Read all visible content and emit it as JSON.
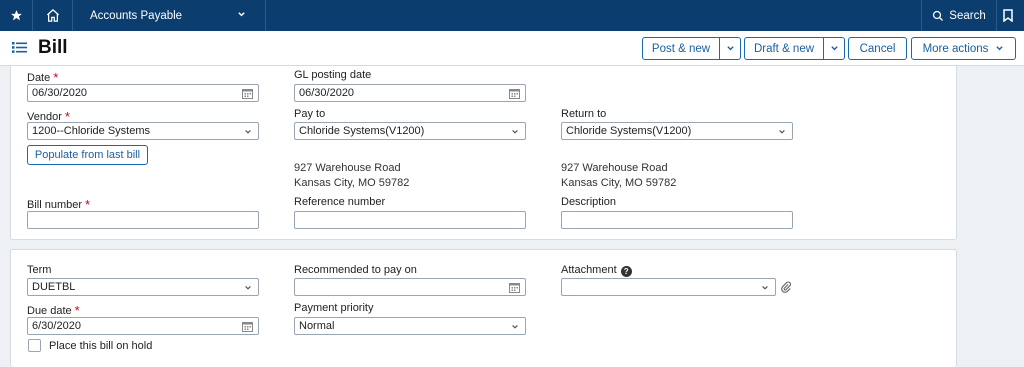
{
  "nav": {
    "module": "Accounts Payable",
    "search_label": "Search"
  },
  "header": {
    "title": "Bill",
    "buttons": {
      "post_new": "Post & new",
      "draft_new": "Draft & new",
      "cancel": "Cancel",
      "more_actions": "More actions"
    }
  },
  "form": {
    "date": {
      "label": "Date",
      "value": "06/30/2020"
    },
    "gl_posting_date": {
      "label": "GL posting date",
      "value": "06/30/2020"
    },
    "vendor": {
      "label": "Vendor",
      "value": "1200--Chloride Systems"
    },
    "pay_to": {
      "label": "Pay to",
      "value": "Chloride Systems(V1200)"
    },
    "return_to": {
      "label": "Return to",
      "value": "Chloride Systems(V1200)"
    },
    "populate_button": "Populate from last bill",
    "pay_to_address": {
      "line1": "927 Warehouse Road",
      "line2": "Kansas City, MO 59782"
    },
    "return_to_address": {
      "line1": "927 Warehouse Road",
      "line2": "Kansas City, MO 59782"
    },
    "bill_number": {
      "label": "Bill number",
      "value": ""
    },
    "reference_number": {
      "label": "Reference number",
      "value": ""
    },
    "description": {
      "label": "Description",
      "value": ""
    },
    "term": {
      "label": "Term",
      "value": "DUETBL"
    },
    "recommended_pay_on": {
      "label": "Recommended to pay on",
      "value": ""
    },
    "attachment": {
      "label": "Attachment",
      "value": ""
    },
    "due_date": {
      "label": "Due date",
      "value": "6/30/2020"
    },
    "payment_priority": {
      "label": "Payment priority",
      "value": "Normal"
    },
    "hold": {
      "label": "Place this bill on hold",
      "checked": false
    }
  },
  "colors": {
    "nav_bg": "#0b3d6e",
    "accent": "#1a5e9f",
    "required": "#d0021b"
  }
}
